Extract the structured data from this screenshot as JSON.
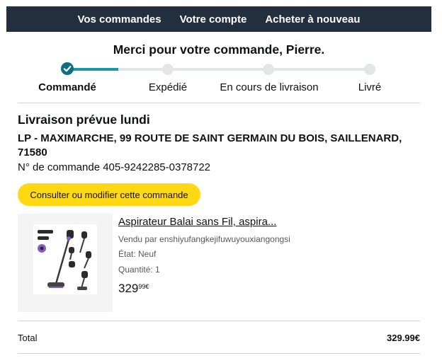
{
  "nav": {
    "orders": "Vos commandes",
    "account": "Votre compte",
    "buy_again": "Acheter à nouveau"
  },
  "header": {
    "thanks": "Merci pour votre commande, Pierre."
  },
  "progress": {
    "steps": [
      "Commandé",
      "Expédié",
      "En cours de livraison",
      "Livré"
    ],
    "current_step": 1
  },
  "delivery": {
    "title": "Livraison prévue lundi",
    "address": "LP - MAXIMARCHE, 99 ROUTE DE SAINT GERMAIN DU BOIS, SAILLENARD, 71580",
    "order_number": "N° de commande 405-9242285-0378722"
  },
  "actions": {
    "manage_order": "Consulter ou modifier cette commande"
  },
  "item": {
    "name": "Aspirateur Balai sans Fil, aspira...",
    "seller": "Vendu par enshiyufangkejifuwuyouxiangongsi",
    "state": "État: Neuf",
    "quantity": "Quantité: 1",
    "price_whole": "329",
    "price_fraction": "99€"
  },
  "summary": {
    "total_label": "Total",
    "total_value": "329.99€"
  },
  "colors": {
    "nav_bg": "#232f3e",
    "progress_active": "#1a98a6",
    "button_yellow": "#ffd814"
  }
}
